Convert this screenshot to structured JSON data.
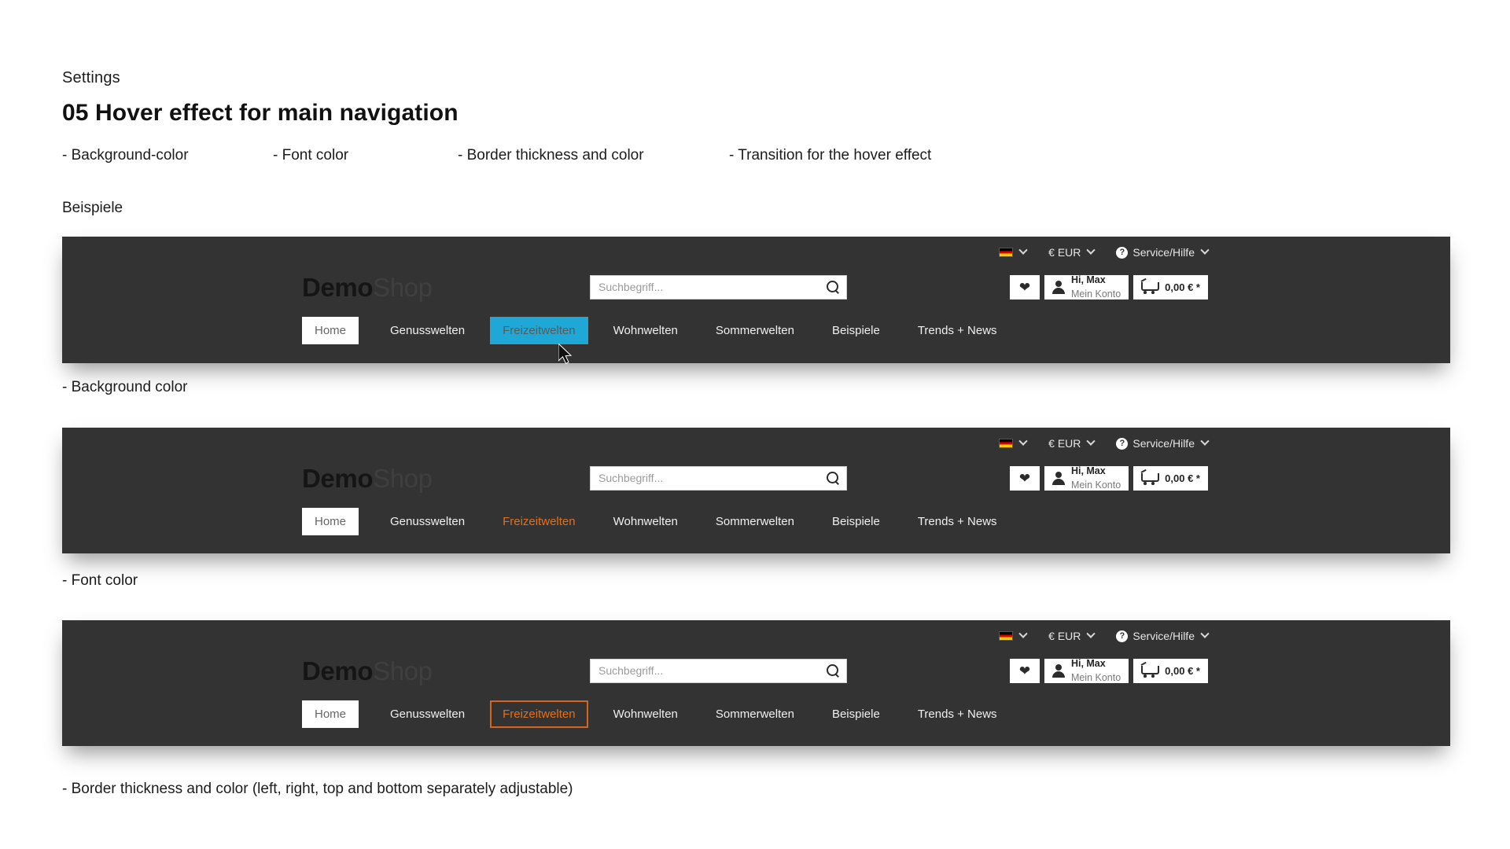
{
  "doc": {
    "eyebrow": "Settings",
    "title": "05 Hover effect for main navigation",
    "bullets": [
      "- Background-color",
      "- Font color",
      "- Border thickness and color",
      "- Transition for the hover effect"
    ],
    "section_label": "Beispiele"
  },
  "shop": {
    "utility": {
      "language_icon": "german-flag-icon",
      "currency": "€ EUR",
      "service": "Service/Hilfe",
      "help_icon": "question-mark-icon",
      "caret_icon": "chevron-down-icon"
    },
    "logo": {
      "bold": "Demo",
      "light": "Shop"
    },
    "search": {
      "placeholder": "Suchbegriff...",
      "value": "",
      "icon": "search-icon"
    },
    "actions": {
      "wishlist_icon": "heart-icon",
      "account_icon": "user-icon",
      "account_greeting": "Hi, Max",
      "account_sub": "Mein Konto",
      "cart_icon": "shopping-cart-icon",
      "cart_total": "0,00 € *"
    },
    "nav": [
      "Home",
      "Genusswelten",
      "Freizeitwelten",
      "Wohnwelten",
      "Sommerwelten",
      "Beispiele",
      "Trends + News"
    ]
  },
  "examples": [
    {
      "hover_style": "background",
      "hover_item": "Freizeitwelten",
      "caption": "- Background color",
      "accent": "#1fa8d6",
      "cursor_visible": true
    },
    {
      "hover_style": "font",
      "hover_item": "Freizeitwelten",
      "caption": "- Font color",
      "accent": "#e2701a",
      "cursor_visible": false
    },
    {
      "hover_style": "border",
      "hover_item": "Freizeitwelten",
      "caption": "- Border thickness and color (left, right, top and bottom separately adjustable)",
      "accent": "#d4651a",
      "cursor_visible": false
    }
  ],
  "colors": {
    "bar_background": "#333333",
    "page_background": "#ffffff",
    "hover_background": "#1fa8d6",
    "hover_font": "#e2701a",
    "hover_border": "#d4651a"
  }
}
